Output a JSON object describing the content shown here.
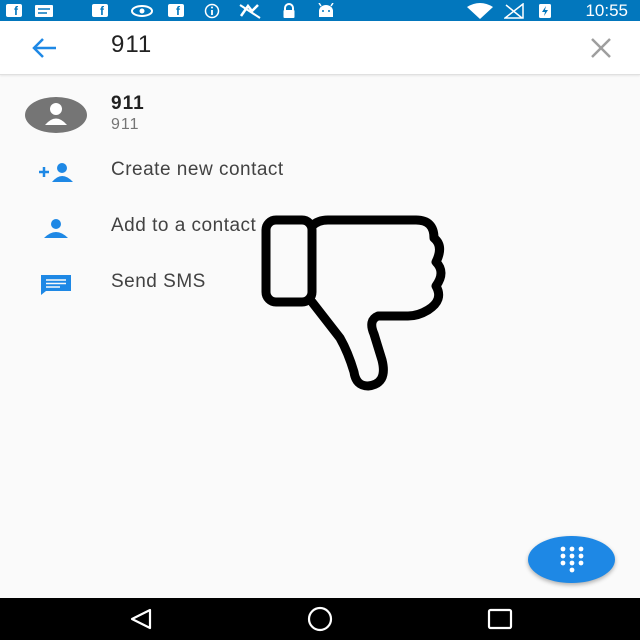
{
  "status_bar": {
    "time": "10:55",
    "icons": [
      "facebook-icon",
      "message-icon",
      "facebook-icon",
      "nvidia-icon",
      "facebook-icon",
      "info-icon",
      "no-sim-icon",
      "lock-icon",
      "android-icon",
      "wifi-icon",
      "signal-off-icon",
      "battery-charging-icon"
    ]
  },
  "search_bar": {
    "query": "911",
    "back_icon": "arrow-back-icon",
    "clear_icon": "close-icon"
  },
  "result": {
    "name": "911",
    "number": "911"
  },
  "actions": [
    {
      "label": "Create new contact",
      "icon": "add-person-icon"
    },
    {
      "label": "Add to a contact",
      "icon": "person-icon"
    },
    {
      "label": "Send SMS",
      "icon": "message-icon"
    }
  ],
  "fab": {
    "icon": "dialpad-icon"
  },
  "nav_bar": {
    "buttons": [
      "back-triangle-icon",
      "home-circle-icon",
      "recents-square-icon"
    ]
  },
  "overlay": {
    "icon": "thumbs-down-icon"
  },
  "colors": {
    "status_bar": "#0277bd",
    "accent": "#1e88e5",
    "icon_blue": "#1e88e5",
    "background": "#fafafa"
  }
}
